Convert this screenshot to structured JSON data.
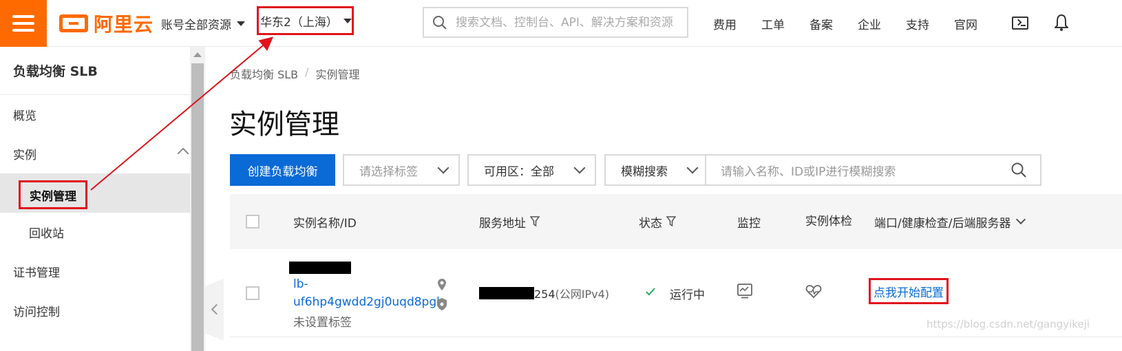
{
  "header": {
    "logo_text": "阿里云",
    "account_scope": "账号全部资源",
    "region": "华东2（上海）",
    "search_placeholder": "搜索文档、控制台、API、解决方案和资源",
    "nav": [
      "费用",
      "工单",
      "备案",
      "企业",
      "支持",
      "官网"
    ],
    "icons": [
      "menu-icon",
      "terminal-icon",
      "bell-icon"
    ]
  },
  "sidebar": {
    "title": "负载均衡 SLB",
    "items": [
      {
        "label": "概览"
      },
      {
        "label": "实例"
      },
      {
        "label": "实例管理"
      },
      {
        "label": "回收站"
      },
      {
        "label": "证书管理"
      },
      {
        "label": "访问控制"
      }
    ]
  },
  "breadcrumb": {
    "root": "负载均衡 SLB",
    "separator": "/",
    "current": "实例管理"
  },
  "page_title": "实例管理",
  "toolbar": {
    "create_button": "创建负载均衡",
    "tag_select_placeholder": "请选择标签",
    "zone_label": "可用区：",
    "zone_value": "全部",
    "search_mode": "模糊搜索",
    "search_placeholder": "请输入名称、ID或IP进行模糊搜索"
  },
  "table": {
    "columns": [
      "实例名称/ID",
      "服务地址",
      "状态",
      "监控",
      "实例体检",
      "端口/健康检查/后端服务器"
    ],
    "rows": [
      {
        "id_line1": "lb-",
        "id_line2": "uf6hp4gwdd2gj0uqd8pgk",
        "tag": "未设置标签",
        "address_suffix": "254",
        "address_type": "(公网IPv4)",
        "status": "运行中",
        "config_link": "点我开始配置"
      }
    ]
  },
  "watermark": "https://blog.csdn.net/gangyikeji",
  "colors": {
    "brand": "#ff6a00",
    "primary": "#0a6bd6",
    "annotation": "#e0131b",
    "success": "#27ae60"
  }
}
